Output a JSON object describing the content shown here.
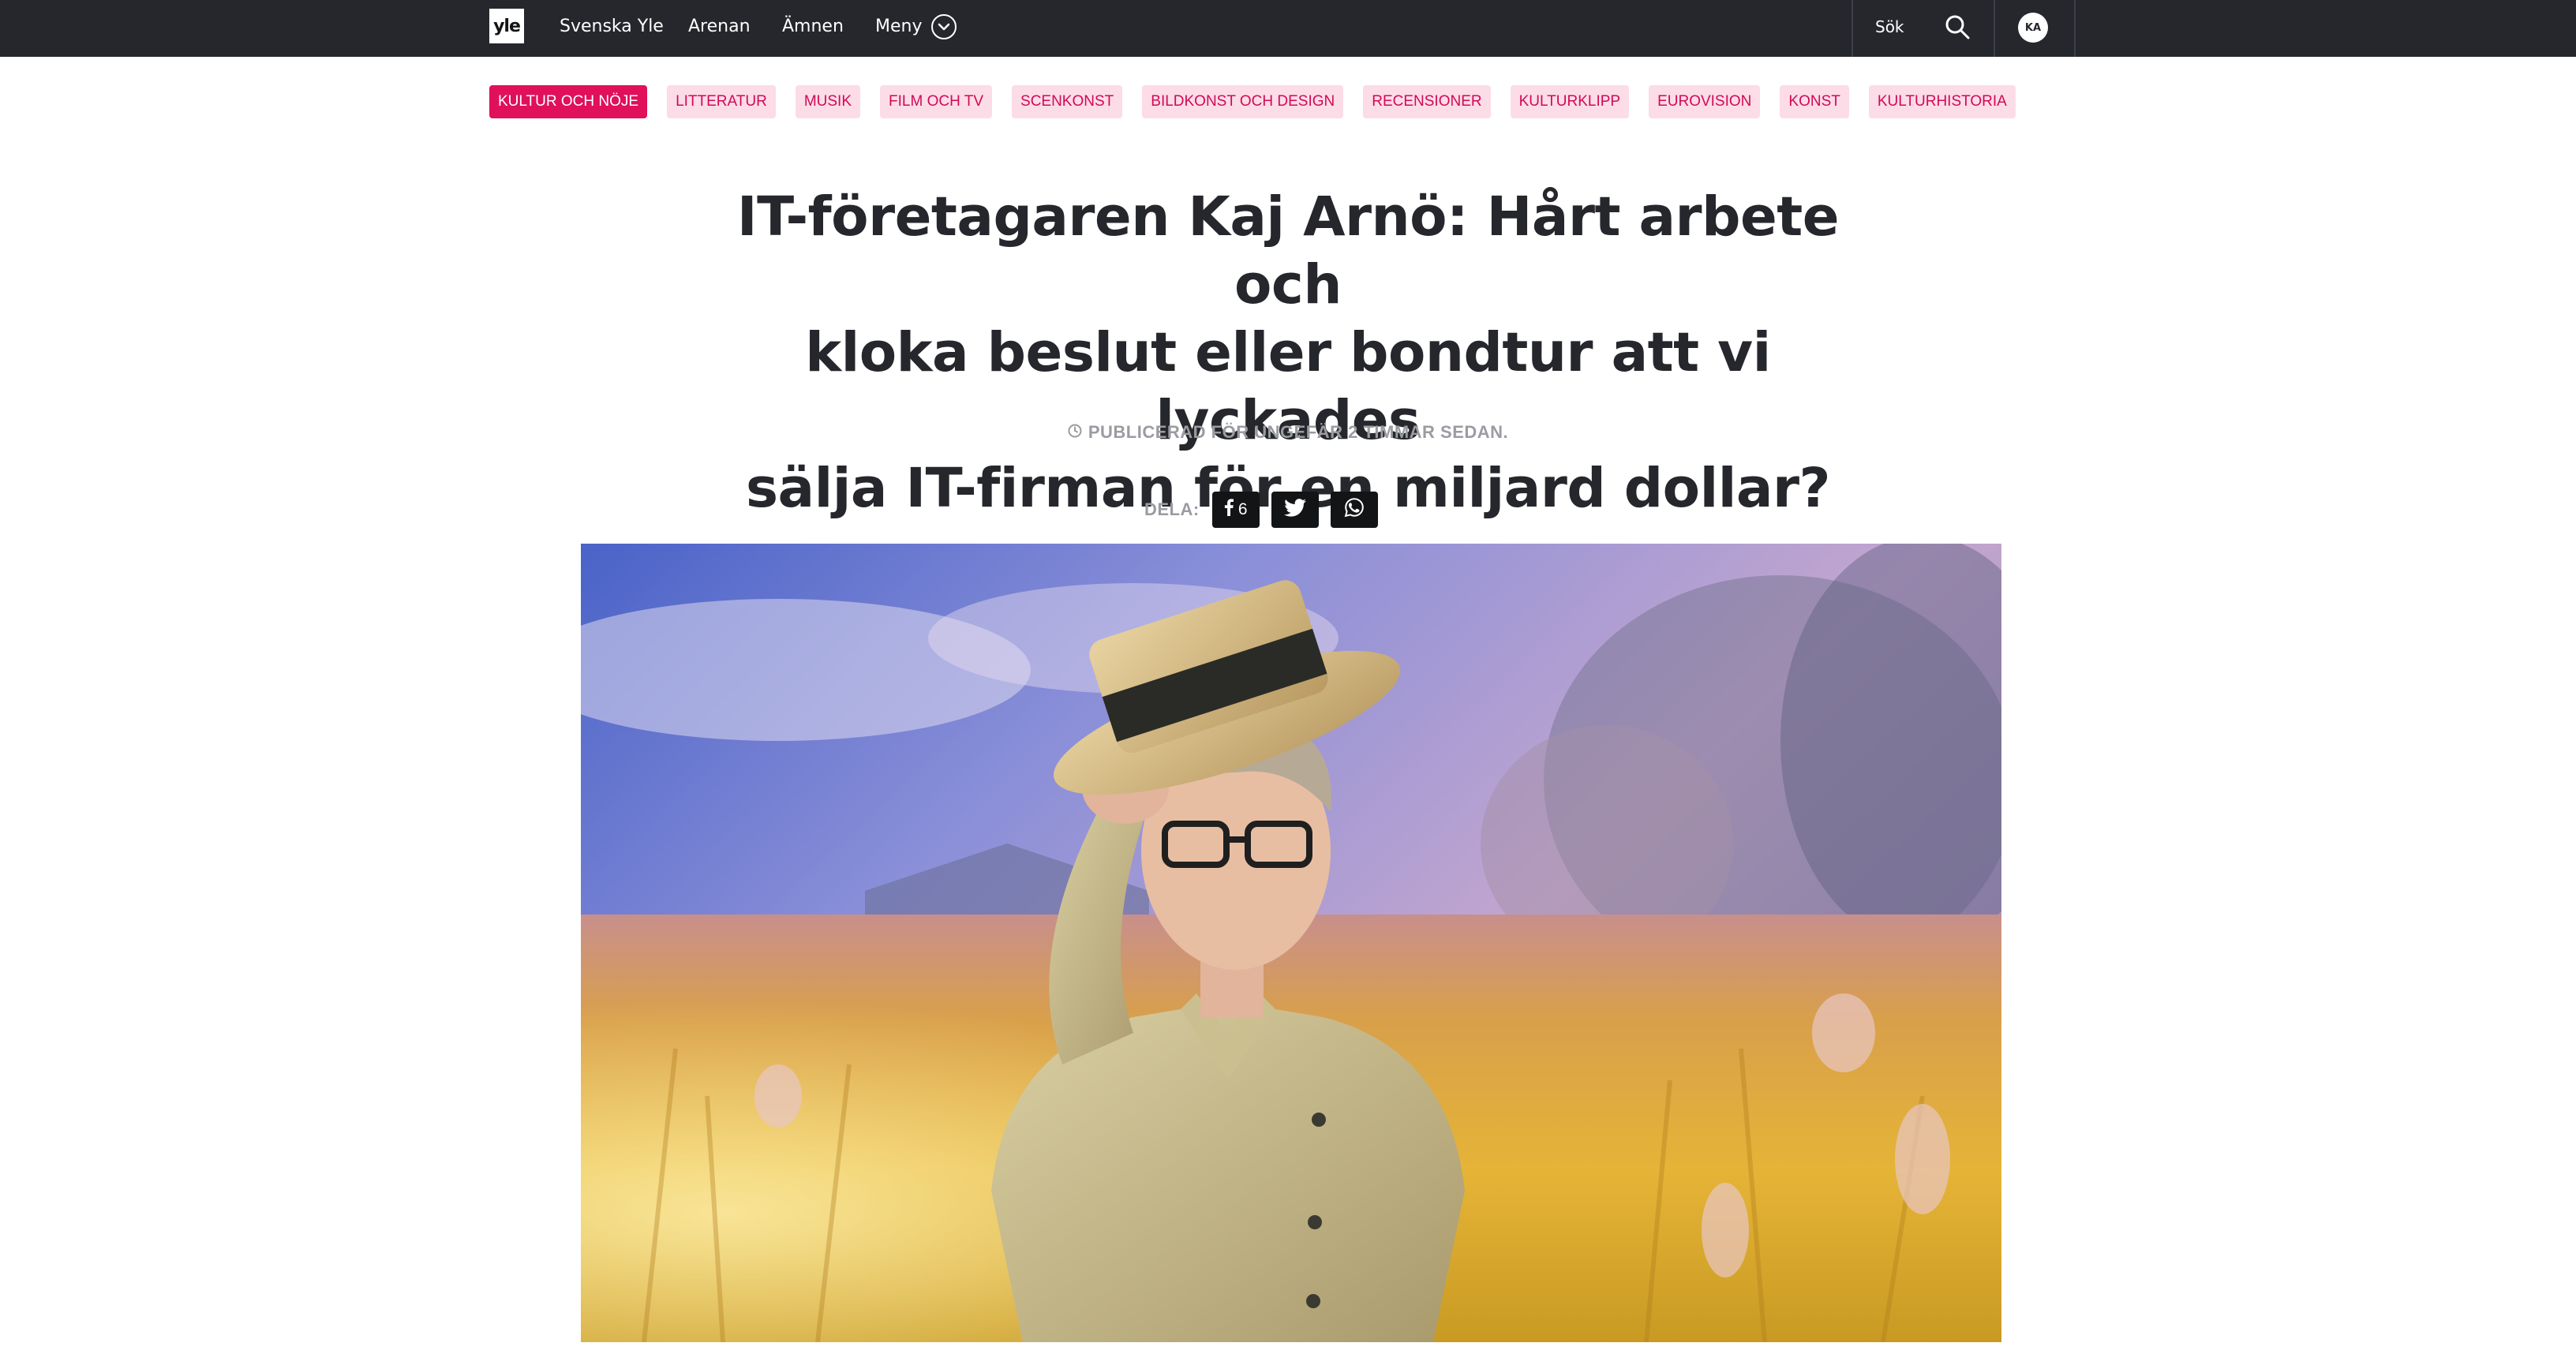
{
  "nav": {
    "logo_text": "yle",
    "links": [
      "Svenska Yle",
      "Arenan",
      "Ämnen"
    ],
    "menu_label": "Meny",
    "search_label": "Sök",
    "avatar_initials": "KA"
  },
  "tags": [
    {
      "label": "KULTUR OCH NÖJE",
      "active": true
    },
    {
      "label": "LITTERATUR",
      "active": false
    },
    {
      "label": "MUSIK",
      "active": false
    },
    {
      "label": "FILM OCH TV",
      "active": false
    },
    {
      "label": "SCENKONST",
      "active": false
    },
    {
      "label": "BILDKONST OCH DESIGN",
      "active": false
    },
    {
      "label": "RECENSIONER",
      "active": false
    },
    {
      "label": "KULTURKLIPP",
      "active": false
    },
    {
      "label": "EUROVISION",
      "active": false
    },
    {
      "label": "KONST",
      "active": false
    },
    {
      "label": "KULTURHISTORIA",
      "active": false
    }
  ],
  "article": {
    "headline_lines": [
      "IT-företagaren Kaj Arnö: Hårt arbete och",
      "kloka beslut eller bondtur att vi lyckades",
      "sälja IT-firman för en miljard dollar?"
    ],
    "published": "PUBLICERAD FÖR UNGEFÄR 2 TIMMAR SEDAN."
  },
  "share": {
    "label": "DELA:",
    "facebook_count": "6",
    "icons": [
      "facebook-icon",
      "twitter-icon",
      "whatsapp-icon"
    ]
  },
  "colors": {
    "nav_bg": "#25272c",
    "tag_active_bg": "#e0105a",
    "tag_bg": "#fcdce7",
    "tag_text": "#d10a55",
    "headline": "#25272c",
    "meta_text": "#9a9ca1"
  }
}
